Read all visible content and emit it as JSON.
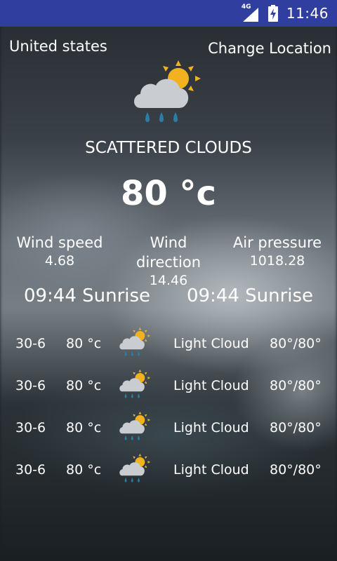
{
  "status_bar": {
    "network": "4G",
    "time": "11:46"
  },
  "header": {
    "location": "United states",
    "change_location": "Change Location"
  },
  "current": {
    "icon": "cloud-sun-rain-icon",
    "description": "SCATTERED CLOUDS",
    "temperature": "80 °c"
  },
  "stats": [
    {
      "label": "Wind speed",
      "value": "4.68"
    },
    {
      "label": "Wind direction",
      "value": "14.46"
    },
    {
      "label": "Air pressure",
      "value": "1018.28"
    }
  ],
  "sun": {
    "first": "09:44 Sunrise",
    "second": "09:44 Sunrise"
  },
  "forecast": [
    {
      "date": "30-6",
      "temp": "80 °c",
      "icon": "cloud-sun-rain-icon",
      "desc": "Light Cloud",
      "range": "80°/80°"
    },
    {
      "date": "30-6",
      "temp": "80 °c",
      "icon": "cloud-sun-rain-icon",
      "desc": "Light Cloud",
      "range": "80°/80°"
    },
    {
      "date": "30-6",
      "temp": "80 °c",
      "icon": "cloud-sun-rain-icon",
      "desc": "Light Cloud",
      "range": "80°/80°"
    },
    {
      "date": "30-6",
      "temp": "80 °c",
      "icon": "cloud-sun-rain-icon",
      "desc": "Light Cloud",
      "range": "80°/80°"
    }
  ],
  "colors": {
    "status_bar": "#303f9f",
    "sun": "#f2b21f",
    "cloud": "#c9ccd0",
    "rain": "#2a7ea6"
  }
}
